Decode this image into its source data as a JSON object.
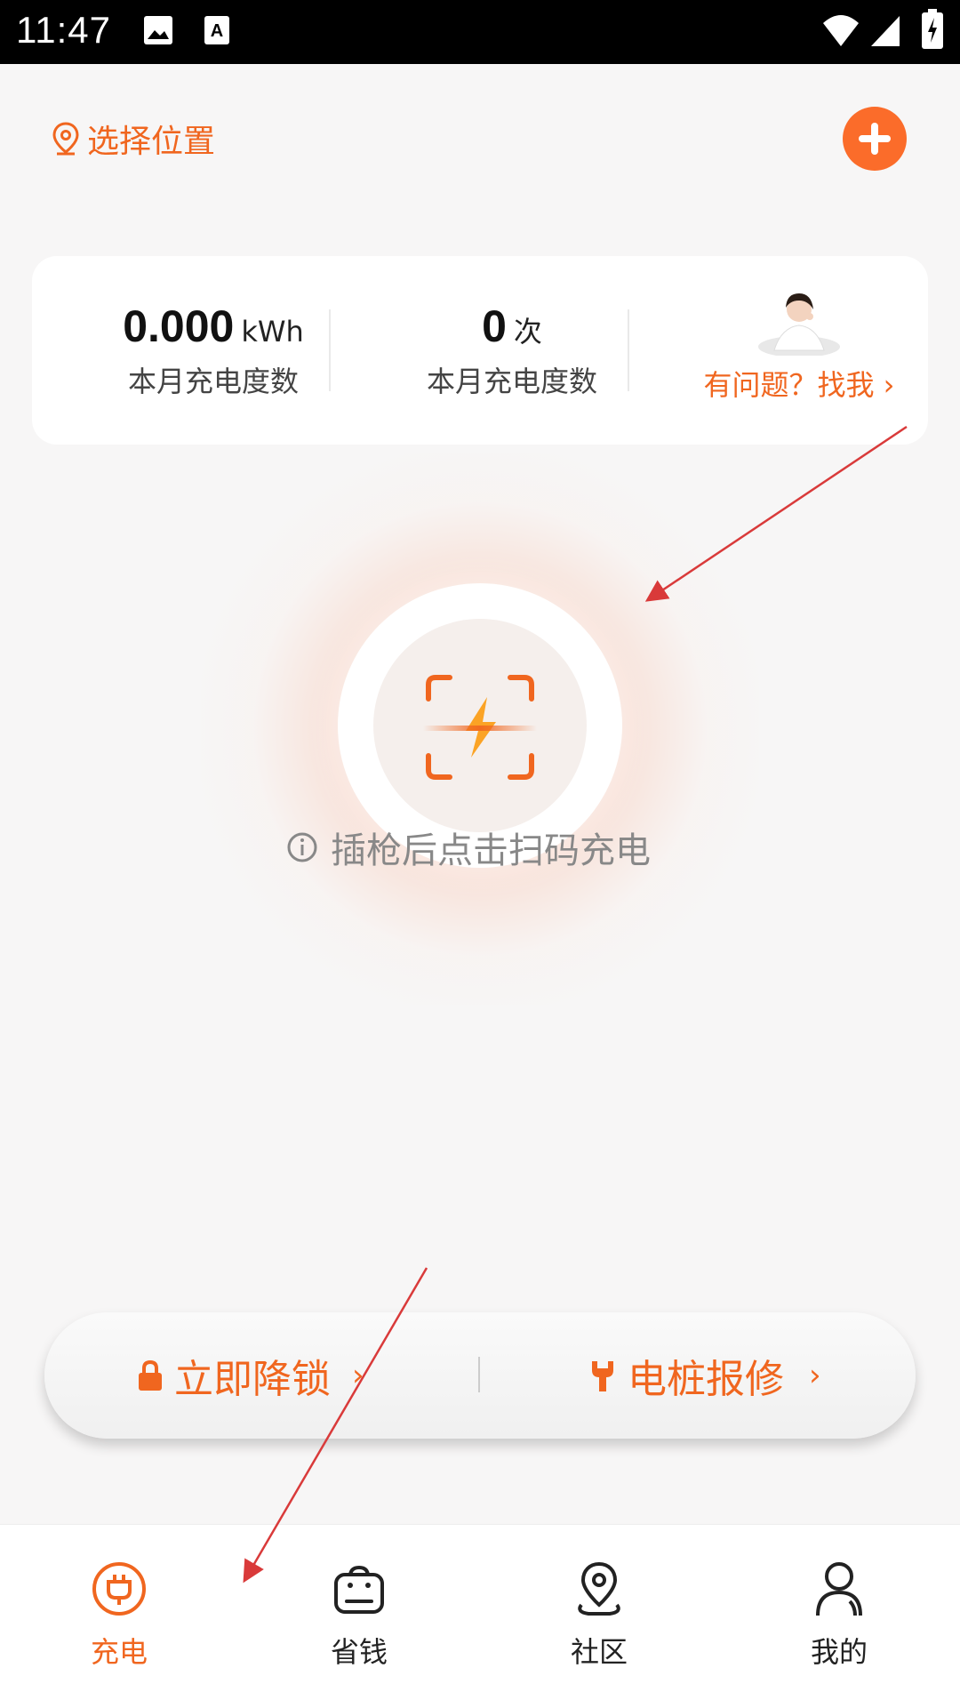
{
  "status_bar": {
    "time": "11:47"
  },
  "header": {
    "location_label": "选择位置"
  },
  "stats": [
    {
      "value": "0.000",
      "unit": "kWh",
      "label": "本月充电度数"
    },
    {
      "value": "0",
      "unit": "次",
      "label": "本月充电度数"
    }
  ],
  "help": {
    "text": "有问题？找我 ›"
  },
  "scan": {
    "hint": "插枪后点击扫码充电"
  },
  "actions": {
    "unlock": {
      "label": "立即降锁",
      "chevron": "›"
    },
    "repair": {
      "label": "电桩报修",
      "chevron": "›"
    }
  },
  "nav": {
    "items": [
      {
        "label": "充电",
        "icon": "plug-icon",
        "active": true
      },
      {
        "label": "省钱",
        "icon": "bag-icon",
        "active": false
      },
      {
        "label": "社区",
        "icon": "location-pin-icon",
        "active": false
      },
      {
        "label": "我的",
        "icon": "person-icon",
        "active": false
      }
    ]
  },
  "colors": {
    "accent": "#f0661f",
    "button": "#fb6c2a",
    "annotation": "#d93a3a"
  }
}
